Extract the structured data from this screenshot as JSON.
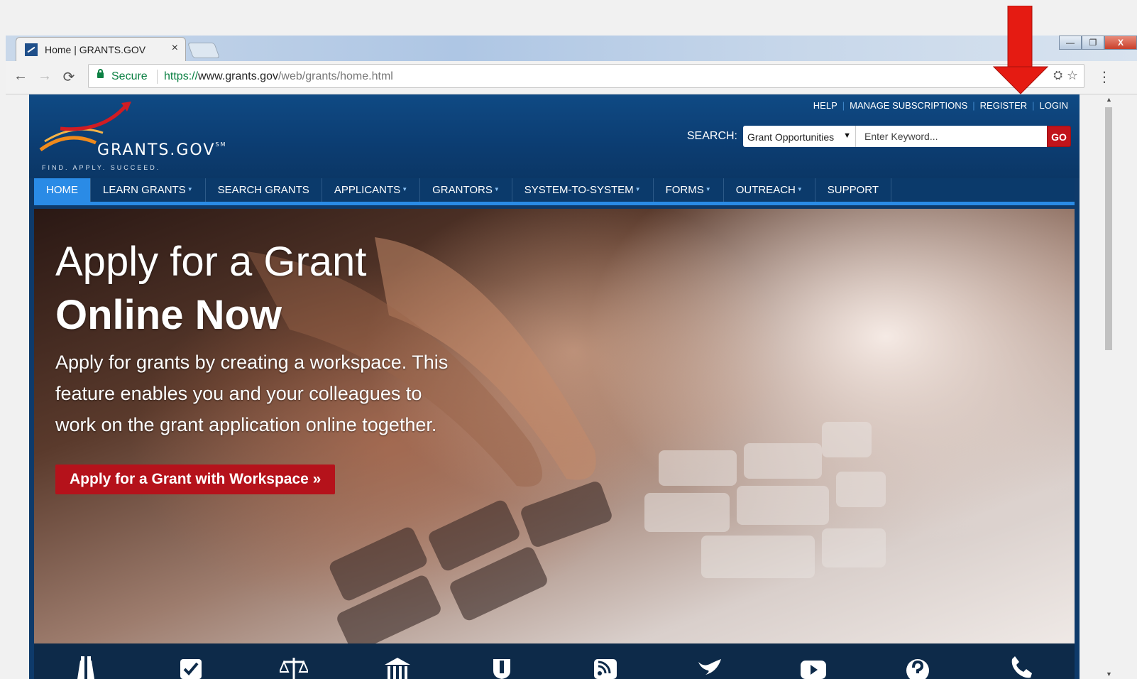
{
  "browser": {
    "tab_title": "Home | GRANTS.GOV",
    "tab_close": "×",
    "secure_label": "Secure",
    "url_scheme": "https://",
    "url_host": "www.grants.gov",
    "url_path": "/web/grants/home.html",
    "back_icon": "←",
    "forward_icon": "→",
    "reload_icon": "⟳",
    "star_icon": "☆",
    "translate_icon": "⛭",
    "menu_icon": "⋮",
    "win_minimize": "—",
    "win_restore": "❐",
    "win_close": "X"
  },
  "site": {
    "logo_text": "GRANTS.GOV",
    "logo_sm": "SM",
    "logo_tagline": "FIND. APPLY. SUCCEED.",
    "utility_links": [
      "HELP",
      "MANAGE SUBSCRIPTIONS",
      "REGISTER",
      "LOGIN"
    ],
    "search": {
      "label": "SEARCH:",
      "select_value": "Grant Opportunities",
      "select_caret": "▼",
      "placeholder": "Enter Keyword...",
      "go": "GO"
    },
    "nav": [
      {
        "label": "HOME",
        "caret": false,
        "active": true
      },
      {
        "label": "LEARN GRANTS",
        "caret": true
      },
      {
        "label": "SEARCH GRANTS",
        "caret": false
      },
      {
        "label": "APPLICANTS",
        "caret": true
      },
      {
        "label": "GRANTORS",
        "caret": true
      },
      {
        "label": "SYSTEM-TO-SYSTEM",
        "caret": true
      },
      {
        "label": "FORMS",
        "caret": true
      },
      {
        "label": "OUTREACH",
        "caret": true
      },
      {
        "label": "SUPPORT",
        "caret": false
      }
    ],
    "nav_caret": "▼",
    "hero": {
      "title_line1": "Apply for a Grant",
      "title_line2": "Online Now",
      "text": "Apply for grants by creating a workspace. This feature enables you and your colleagues to work on the grant application online together.",
      "cta": "Apply for a Grant with Workspace »"
    },
    "bottom_icons": [
      "binoculars-icon",
      "checkbox-icon",
      "scales-icon",
      "institution-icon",
      "shield-icon",
      "rss-icon",
      "twitter-icon",
      "youtube-icon",
      "question-icon",
      "phone-icon"
    ]
  },
  "colors": {
    "header_blue": "#0f4a84",
    "nav_active": "#2a8be6",
    "cta_red": "#b5121b",
    "annotation_red": "#e51b12"
  }
}
